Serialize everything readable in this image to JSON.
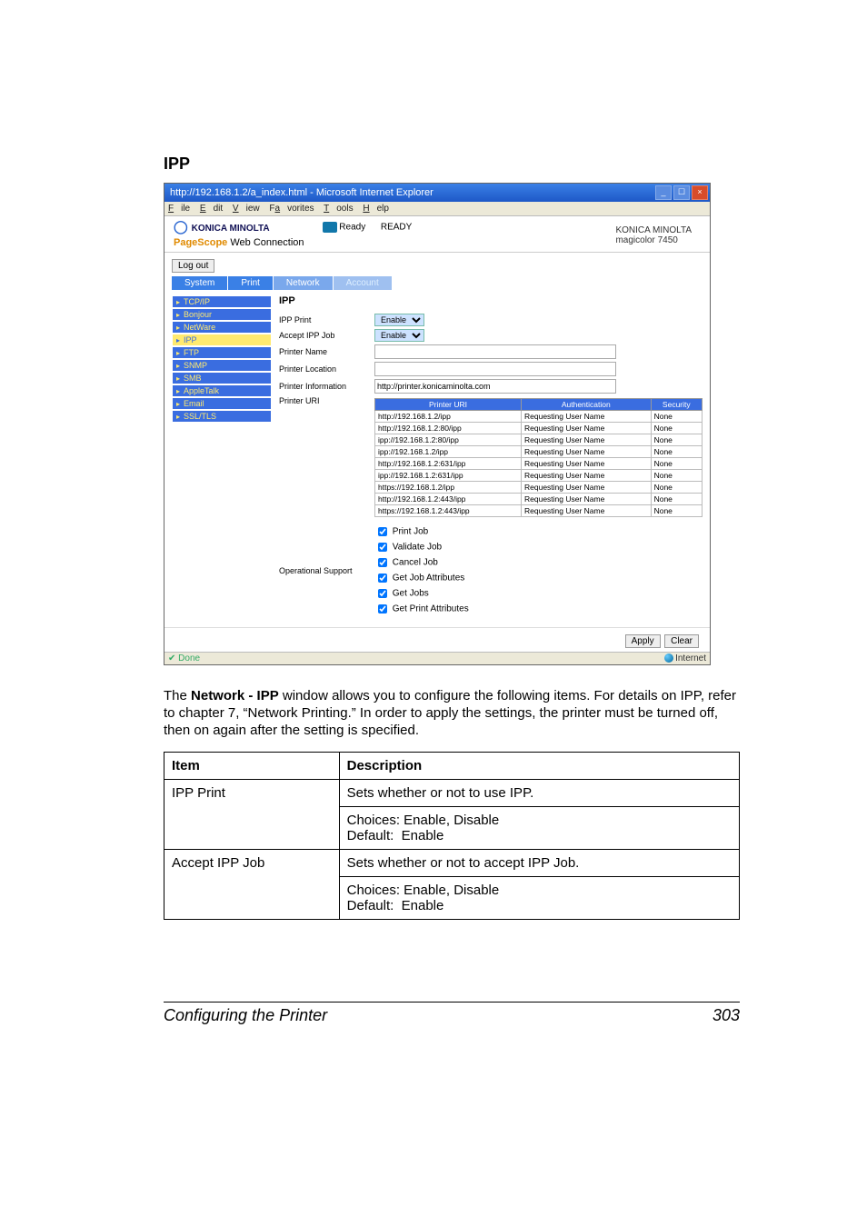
{
  "heading": "IPP",
  "browser": {
    "title": "http://192.168.1.2/a_index.html - Microsoft Internet Explorer",
    "menubar": [
      "File",
      "Edit",
      "View",
      "Favorites",
      "Tools",
      "Help"
    ]
  },
  "header": {
    "brand": "KONICA MINOLTA",
    "subbrand_prefix": "PageScope",
    "subbrand": "Web Connection",
    "status_label": "Ready",
    "status_header": "READY",
    "printer_brand": "KONICA MINOLTA",
    "printer_model": "magicolor 7450",
    "logout": "Log out"
  },
  "tabs": [
    "System",
    "Print",
    "Network",
    "Account"
  ],
  "leftnav": [
    {
      "label": "TCP/IP"
    },
    {
      "label": "Bonjour"
    },
    {
      "label": "NetWare"
    },
    {
      "label": "IPP",
      "selected": true
    },
    {
      "label": "FTP"
    },
    {
      "label": "SNMP"
    },
    {
      "label": "SMB"
    },
    {
      "label": "AppleTalk"
    },
    {
      "label": "Email"
    },
    {
      "label": "SSL/TLS"
    }
  ],
  "panel": {
    "title": "IPP",
    "fields": [
      {
        "label": "IPP Print",
        "type": "select",
        "value": "Enable"
      },
      {
        "label": "Accept IPP Job",
        "type": "select",
        "value": "Enable"
      },
      {
        "label": "Printer Name",
        "type": "text",
        "value": ""
      },
      {
        "label": "Printer Location",
        "type": "text",
        "value": ""
      },
      {
        "label": "Printer Information",
        "type": "text",
        "value": "http://printer.konicaminolta.com"
      }
    ],
    "uri_label": "Printer URI",
    "uri_headers": [
      "Printer URI",
      "Authentication",
      "Security"
    ],
    "uris": [
      {
        "uri": "http://192.168.1.2/ipp",
        "auth": "Requesting User Name",
        "sec": "None"
      },
      {
        "uri": "http://192.168.1.2:80/ipp",
        "auth": "Requesting User Name",
        "sec": "None"
      },
      {
        "uri": "ipp://192.168.1.2:80/ipp",
        "auth": "Requesting User Name",
        "sec": "None"
      },
      {
        "uri": "ipp://192.168.1.2/ipp",
        "auth": "Requesting User Name",
        "sec": "None"
      },
      {
        "uri": "http://192.168.1.2:631/ipp",
        "auth": "Requesting User Name",
        "sec": "None"
      },
      {
        "uri": "ipp://192.168.1.2:631/ipp",
        "auth": "Requesting User Name",
        "sec": "None"
      },
      {
        "uri": "https://192.168.1.2/ipp",
        "auth": "Requesting User Name",
        "sec": "None"
      },
      {
        "uri": "http://192.168.1.2:443/ipp",
        "auth": "Requesting User Name",
        "sec": "None"
      },
      {
        "uri": "https://192.168.1.2:443/ipp",
        "auth": "Requesting User Name",
        "sec": "None"
      }
    ],
    "ops_label": "Operational Support",
    "ops": [
      "Print Job",
      "Validate Job",
      "Cancel Job",
      "Get Job Attributes",
      "Get Jobs",
      "Get Print Attributes"
    ],
    "apply": "Apply",
    "clear": "Clear"
  },
  "statusbar": {
    "left": "Done",
    "right": "Internet"
  },
  "paragraph": "The Network - IPP window allows you to configure the following items. For details on IPP, refer to chapter 7, “Network Printing.” In order to apply the settings, the printer must be turned off, then on again after the setting is specified.",
  "table": {
    "headers": [
      "Item",
      "Description"
    ],
    "rows": [
      {
        "item": "IPP Print",
        "c1": "Sets whether or not to use IPP.",
        "c2": "Choices: Enable, Disable\nDefault:  Enable"
      },
      {
        "item": "Accept IPP Job",
        "c1": "Sets whether or not to accept IPP Job.",
        "c2": "Choices: Enable, Disable\nDefault:  Enable"
      }
    ]
  },
  "footer": {
    "title": "Configuring the Printer",
    "page": "303"
  }
}
